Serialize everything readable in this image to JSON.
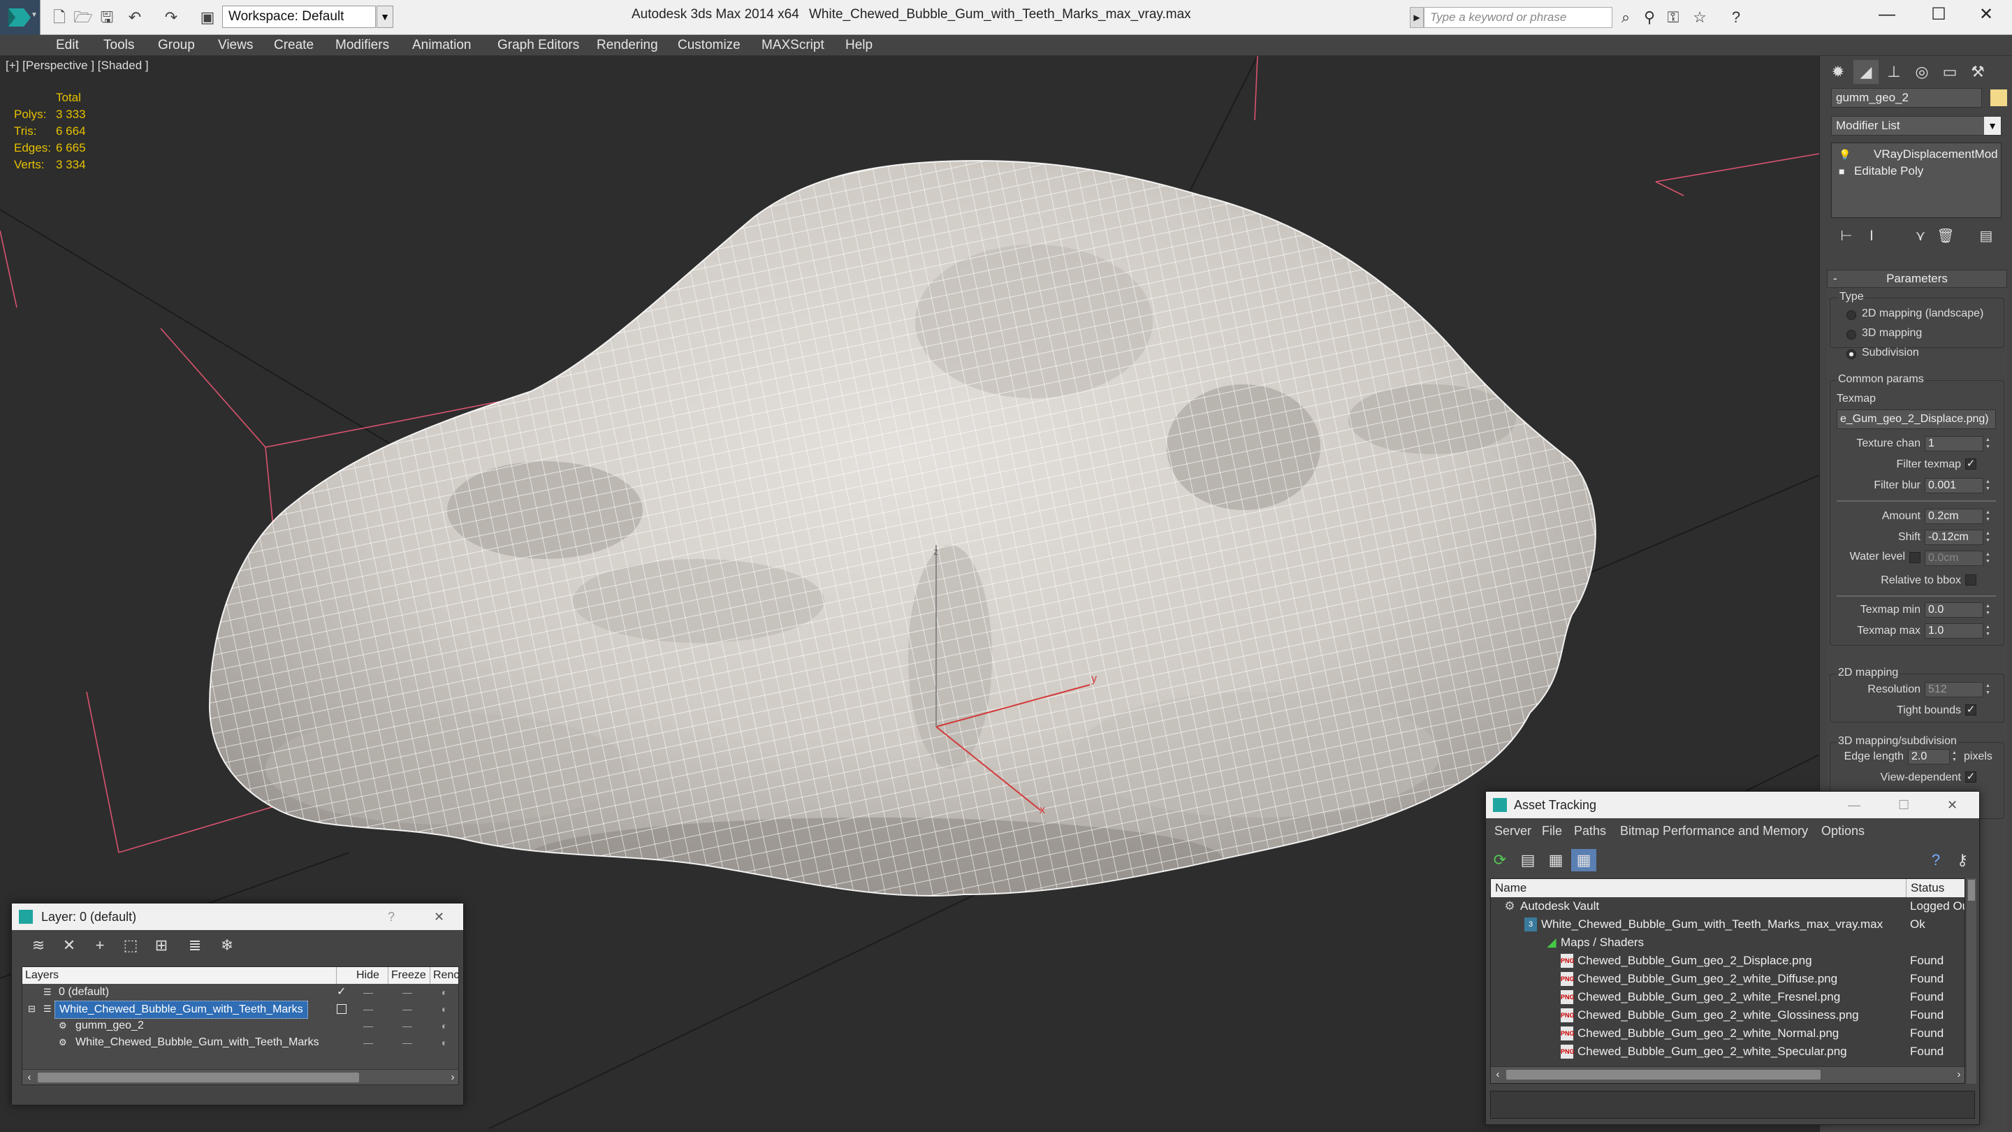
{
  "titlebar": {
    "workspace": "Workspace: Default",
    "app_title": "Autodesk 3ds Max 2014 x64",
    "file_title": "White_Chewed_Bubble_Gum_with_Teeth_Marks_max_vray.max",
    "search_placeholder": "Type a keyword or phrase",
    "quick_access_icons": [
      "new-icon",
      "open-icon",
      "save-icon",
      "undo-icon",
      "redo-icon",
      "project-icon"
    ],
    "tool_icons": [
      "binoculars-icon",
      "communication-center-icon",
      "subscription-icon",
      "favorites-icon",
      "help-icon"
    ],
    "window_controls": [
      "minimize-icon",
      "maximize-icon",
      "close-icon"
    ]
  },
  "menu": [
    "Edit",
    "Tools",
    "Group",
    "Views",
    "Create",
    "Modifiers",
    "Animation",
    "Graph Editors",
    "Rendering",
    "Customize",
    "MAXScript",
    "Help"
  ],
  "viewport": {
    "label": "[+] [Perspective ] [Shaded ]",
    "stats": {
      "header": "Total",
      "rows": [
        {
          "k": "Polys:",
          "v": "3 333"
        },
        {
          "k": "Tris:",
          "v": "6 664"
        },
        {
          "k": "Edges:",
          "v": "6 665"
        },
        {
          "k": "Verts:",
          "v": "3 334"
        }
      ]
    },
    "gizmo": {
      "x": "x",
      "y": "y",
      "z": "z"
    },
    "mesh_color": "#d7d2cc",
    "wire_color": "#ffffff"
  },
  "command_panel": {
    "tabs": [
      "create-icon",
      "modify-icon",
      "hierarchy-icon",
      "motion-icon",
      "display-icon",
      "utilities-icon"
    ],
    "object_name": "gumm_geo_2",
    "object_color": "#f2d98a",
    "modifier_list": "Modifier List",
    "stack": [
      {
        "icon": "lightbulb-icon",
        "label": "VRayDisplacementMod"
      },
      {
        "icon": "editable-poly-icon",
        "label": "Editable Poly"
      }
    ],
    "stack_buttons": [
      "pin-stack-icon",
      "show-end-result-icon",
      "make-unique-icon",
      "remove-modifier-icon",
      "configure-sets-icon"
    ],
    "parameters": {
      "title": "Parameters",
      "type_group": "Type",
      "types": [
        "2D mapping (landscape)",
        "3D mapping",
        "Subdivision"
      ],
      "selected_type": "Subdivision",
      "common_params": "Common params",
      "texmap_label": "Texmap",
      "texmap_value": "e_Gum_geo_2_Displace.png)",
      "texture_chan_label": "Texture chan",
      "texture_chan": "1",
      "filter_texmap_label": "Filter texmap",
      "filter_blur_label": "Filter blur",
      "filter_blur": "0.001",
      "amount_label": "Amount",
      "amount": "0.2cm",
      "shift_label": "Shift",
      "shift": "-0.12cm",
      "water_level_label": "Water level",
      "water_level": "0.0cm",
      "relative_bbox_label": "Relative to bbox",
      "texmap_min_label": "Texmap min",
      "texmap_min": "0.0",
      "texmap_max_label": "Texmap max",
      "texmap_max": "1.0",
      "mapping2d_group": "2D mapping",
      "resolution_label": "Resolution",
      "resolution": "512",
      "tight_bounds_label": "Tight bounds",
      "mapping3d_group": "3D mapping/subdivision",
      "edge_length_label": "Edge length",
      "edge_length": "2.0",
      "pixels_label": "pixels",
      "view_dependent_label": "View-dependent"
    }
  },
  "layer_window": {
    "title": "Layer: 0 (default)",
    "help": "?",
    "close": "✕",
    "toolbar": [
      "new-layer-icon",
      "delete-layer-icon",
      "add-to-layer-icon",
      "select-in-layer-icon",
      "highlight-layer-icon",
      "hide-all-icon",
      "freeze-all-icon"
    ],
    "columns": [
      "Layers",
      "Hide",
      "Freeze",
      "Renc"
    ],
    "rows": [
      {
        "name": "0 (default)",
        "indent": 0,
        "active": true,
        "selected": false
      },
      {
        "name": "White_Chewed_Bubble_Gum_with_Teeth_Marks",
        "indent": 0,
        "active": false,
        "selected": true
      },
      {
        "name": "gumm_geo_2",
        "indent": 1,
        "active": false,
        "selected": false
      },
      {
        "name": "White_Chewed_Bubble_Gum_with_Teeth_Marks",
        "indent": 1,
        "active": false,
        "selected": false
      }
    ]
  },
  "asset_window": {
    "title": "Asset Tracking",
    "menu": [
      "Server",
      "File",
      "Paths",
      "Bitmap Performance and Memory",
      "Options"
    ],
    "toolbar": [
      "refresh-icon",
      "list-view-icon",
      "tree-view-icon",
      "table-view-icon"
    ],
    "toolbar_right": [
      "help-icon",
      "vault-login-icon"
    ],
    "columns": [
      "Name",
      "Status"
    ],
    "rows": [
      {
        "icon": "vault",
        "name": "Autodesk Vault",
        "status": "Logged Ou",
        "level": 0
      },
      {
        "icon": "max",
        "name": "White_Chewed_Bubble_Gum_with_Teeth_Marks_max_vray.max",
        "status": "Ok",
        "level": 1
      },
      {
        "icon": "maps",
        "name": "Maps / Shaders",
        "status": "",
        "level": 2
      },
      {
        "icon": "png",
        "name": "Chewed_Bubble_Gum_geo_2_Displace.png",
        "status": "Found",
        "level": 3
      },
      {
        "icon": "png",
        "name": "Chewed_Bubble_Gum_geo_2_white_Diffuse.png",
        "status": "Found",
        "level": 3
      },
      {
        "icon": "png",
        "name": "Chewed_Bubble_Gum_geo_2_white_Fresnel.png",
        "status": "Found",
        "level": 3
      },
      {
        "icon": "png",
        "name": "Chewed_Bubble_Gum_geo_2_white_Glossiness.png",
        "status": "Found",
        "level": 3
      },
      {
        "icon": "png",
        "name": "Chewed_Bubble_Gum_geo_2_white_Normal.png",
        "status": "Found",
        "level": 3
      },
      {
        "icon": "png",
        "name": "Chewed_Bubble_Gum_geo_2_white_Specular.png",
        "status": "Found",
        "level": 3
      }
    ]
  }
}
